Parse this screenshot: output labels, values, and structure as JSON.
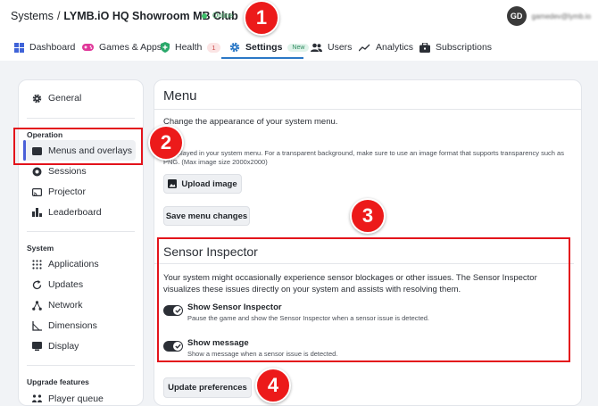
{
  "header": {
    "crumb_root": "Systems",
    "crumb_sep": "/",
    "crumb_club": "LYMB.iO HQ Showroom MB Club",
    "status": "Online",
    "avatar_initials": "GD",
    "user_email": "gamedev@lymb.io"
  },
  "nav": {
    "dashboard": "Dashboard",
    "games": "Games & Apps",
    "health": "Health",
    "health_count": "1",
    "settings": "Settings",
    "settings_badge": "New",
    "users": "Users",
    "analytics": "Analytics",
    "subscriptions": "Subscriptions"
  },
  "sidebar": {
    "general": "General",
    "operation_heading": "Operation",
    "menus": "Menus and overlays",
    "sessions": "Sessions",
    "projector": "Projector",
    "leaderboard": "Leaderboard",
    "system_heading": "System",
    "applications": "Applications",
    "updates": "Updates",
    "network": "Network",
    "dimensions": "Dimensions",
    "display": "Display",
    "upgrade_heading": "Upgrade features",
    "player_queue": "Player queue"
  },
  "menu": {
    "title": "Menu",
    "description": "Change the appearance of your system menu.",
    "image_help": "...displayed in your system menu. For a transparent background, make sure to use an image format that supports transparency such as PNG. (Max image size 2000x2000)",
    "upload_label": "Upload image",
    "save_label": "Save menu changes"
  },
  "sensor": {
    "title": "Sensor Inspector",
    "description": "Your system might occasionally experience sensor blockages or other issues. The Sensor Inspector visualizes these issues directly on your system and assists with resolving them.",
    "opt1_title": "Show Sensor Inspector",
    "opt1_sub": "Pause the game and show the Sensor Inspector when a sensor issue is detected.",
    "opt1_on": true,
    "opt2_title": "Show message",
    "opt2_sub": "Show a message when a sensor issue is detected.",
    "opt2_on": true,
    "update_label": "Update preferences"
  },
  "markers": {
    "m1": "1",
    "m2": "2",
    "m3": "3",
    "m4": "4"
  },
  "colors": {
    "accent": "#2b78c6",
    "annotation_red": "#e3131b",
    "online_green": "#3fbf6a"
  }
}
